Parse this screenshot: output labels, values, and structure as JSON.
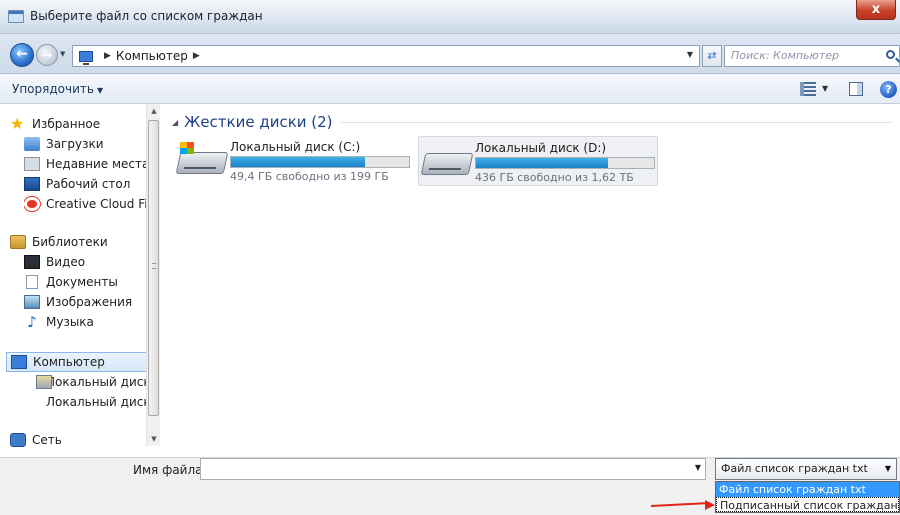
{
  "window": {
    "title": "Выберите файл со списком граждан",
    "close_glyph": "x"
  },
  "address": {
    "segments": [
      "Компьютер"
    ],
    "search_placeholder": "Поиск: Компьютер"
  },
  "toolbar": {
    "organize_label": "Упорядочить",
    "help_glyph": "?"
  },
  "navigation": {
    "favorites": {
      "label": "Избранное",
      "items": [
        {
          "label": "Загрузки",
          "icon": "downloads-icon"
        },
        {
          "label": "Недавние места",
          "icon": "recent-places-icon"
        },
        {
          "label": "Рабочий стол",
          "icon": "desktop-icon"
        },
        {
          "label": "Creative Cloud Fi",
          "icon": "creative-cloud-icon"
        }
      ]
    },
    "libraries": {
      "label": "Библиотеки",
      "items": [
        {
          "label": "Видео",
          "icon": "video-icon"
        },
        {
          "label": "Документы",
          "icon": "documents-icon"
        },
        {
          "label": "Изображения",
          "icon": "images-icon"
        },
        {
          "label": "Музыка",
          "icon": "music-icon"
        }
      ]
    },
    "computer": {
      "label": "Компьютер",
      "items": [
        {
          "label": "Локальный диск",
          "icon": "local-disk-icon"
        },
        {
          "label": "Локальный диск",
          "icon": "local-disk-icon"
        }
      ]
    },
    "network": {
      "label": "Сеть"
    }
  },
  "content": {
    "group_title": "Жесткие диски (2)",
    "drives": [
      {
        "name": "Локальный диск (C:)",
        "free_text": "49,4 ГБ свободно из 199 ГБ",
        "used_fraction": 0.75
      },
      {
        "name": "Локальный диск (D:)",
        "free_text": "436 ГБ свободно из 1,62 ТБ",
        "used_fraction": 0.74
      }
    ]
  },
  "bottom": {
    "filename_label": "Имя файла:",
    "filename_value": "",
    "filter_selected": "Файл список граждан txt",
    "filter_options": [
      "Файл список граждан txt",
      "Подписанный список граждан sgn"
    ]
  },
  "colors": {
    "annotation_arrow": "#e3241b",
    "selection": "#3399ff",
    "drive_bar": "#1a82c7"
  }
}
